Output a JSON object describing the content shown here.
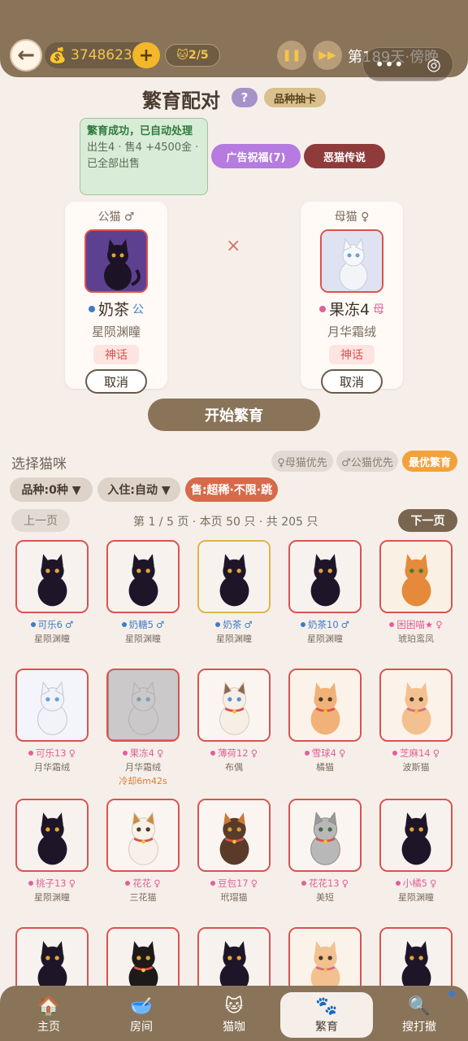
{
  "header": {
    "back_icon": "back-arrow-icon",
    "coins": "3748623",
    "add": "+",
    "cat_slots": "2/5",
    "day_text": "第189天·傍晚"
  },
  "title": {
    "text": "繁育配对",
    "help": "?",
    "breed_draw": "品种抽卡"
  },
  "notice": {
    "headline": "繁育成功，已自动处理",
    "detail": "出生4 · 售4 +4500金 · 已全部出售"
  },
  "ad_button": "广告祝福(7)",
  "legend_button": "恶猫传说",
  "male": {
    "role": "公猫 ♂",
    "name": "奶茶",
    "gender_tag": "公",
    "breed": "星陨渊瞳",
    "rarity": "神话",
    "cancel": "取消"
  },
  "female": {
    "role": "母猫 ♀",
    "name": "果冻4",
    "gender_tag": "母",
    "breed": "月华霜绒",
    "rarity": "神话",
    "cancel": "取消"
  },
  "cross": "×",
  "start_button": "开始繁育",
  "select": {
    "label": "选择猫咪",
    "female_first": "♀母猫优先",
    "male_first": "♂公猫优先",
    "best": "最优繁育",
    "filter_breed": "品种:0种 ▼",
    "filter_stay": "入住:自动 ▼",
    "filter_sell": "售:超稀·不限·跳",
    "prev": "上一页",
    "page_info": "第 1 / 5 页 · 本页 50 只 · 共 205 只",
    "next": "下一页"
  },
  "cats": [
    {
      "name": "可乐6",
      "sex": "♂",
      "breed": "星陨渊瞳",
      "kind": "black"
    },
    {
      "name": "奶糖5",
      "sex": "♂",
      "breed": "星陨渊瞳",
      "kind": "black"
    },
    {
      "name": "奶茶",
      "sex": "♂",
      "breed": "星陨渊瞳",
      "kind": "black"
    },
    {
      "name": "奶茶10",
      "sex": "♂",
      "breed": "星陨渊瞳",
      "kind": "black"
    },
    {
      "name": "困困喵★",
      "sex": "♀",
      "breed": "琥珀鸾凤",
      "kind": "orange"
    },
    {
      "name": "可乐13",
      "sex": "♀",
      "breed": "月华霜绒",
      "kind": "white"
    },
    {
      "name": "果冻4",
      "sex": "♀",
      "breed": "月华霜绒",
      "kind": "white",
      "cooldown": "冷却6m42s"
    },
    {
      "name": "薄荷12",
      "sex": "♀",
      "breed": "布偶",
      "kind": "ragdoll"
    },
    {
      "name": "雪球4",
      "sex": "♀",
      "breed": "橘猫",
      "kind": "ginger"
    },
    {
      "name": "芝麻14",
      "sex": "♀",
      "breed": "波斯猫",
      "kind": "persian"
    },
    {
      "name": "桃子13",
      "sex": "♀",
      "breed": "星陨渊瞳",
      "kind": "black"
    },
    {
      "name": "花花",
      "sex": "♀",
      "breed": "三花猫",
      "kind": "calico"
    },
    {
      "name": "豆包17",
      "sex": "♀",
      "breed": "玳瑁猫",
      "kind": "tortie"
    },
    {
      "name": "花花13",
      "sex": "♀",
      "breed": "美短",
      "kind": "tabby"
    },
    {
      "name": "小橘5",
      "sex": "♀",
      "breed": "星陨渊瞳",
      "kind": "black"
    },
    {
      "kind": "black"
    },
    {
      "kind": "blackbell"
    },
    {
      "kind": "black"
    },
    {
      "kind": "persian"
    },
    {
      "kind": "black"
    }
  ],
  "nav": {
    "home": "主页",
    "room": "房间",
    "cafe": "猫咖",
    "breed": "繁育",
    "explore": "搜打撤"
  },
  "colors": {
    "brown": "#8a7459",
    "male": "#3d7cc9",
    "female": "#e0609a",
    "mythic_red": "#d9534f",
    "best_orange": "#f2a23b"
  }
}
